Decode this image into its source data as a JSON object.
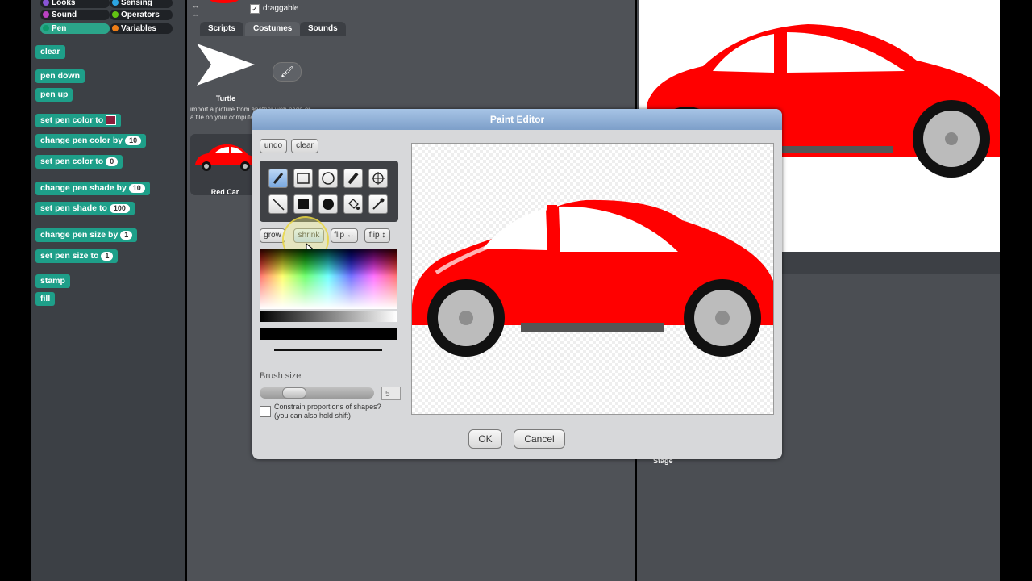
{
  "palette": {
    "categories": [
      {
        "label": "Looks",
        "color": "#8a55d7",
        "selected": false
      },
      {
        "label": "Sensing",
        "color": "#2ca5e2",
        "selected": false
      },
      {
        "label": "Sound",
        "color": "#bb42c3",
        "selected": false
      },
      {
        "label": "Operators",
        "color": "#62c213",
        "selected": false
      },
      {
        "label": "Pen",
        "color": "#0e9a6c",
        "selected": true
      },
      {
        "label": "Variables",
        "color": "#ee7d16",
        "selected": false
      }
    ],
    "blocks": {
      "clear": "clear",
      "pen_down": "pen down",
      "pen_up": "pen up",
      "set_pen_color": "set pen color to",
      "change_pen_color": "change pen color by",
      "change_pen_color_val": "10",
      "set_pen_color_num": "set pen color to",
      "set_pen_color_num_val": "0",
      "change_pen_shade": "change pen shade by",
      "change_pen_shade_val": "10",
      "set_pen_shade": "set pen shade to",
      "set_pen_shade_val": "100",
      "change_pen_size": "change pen size by",
      "change_pen_size_val": "1",
      "set_pen_size": "set pen size to",
      "set_pen_size_val": "1",
      "stamp": "stamp",
      "fill": "fill"
    }
  },
  "sprite": {
    "draggable_label": "draggable",
    "tabs": [
      "Scripts",
      "Costumes",
      "Sounds"
    ],
    "costumes": [
      {
        "name": "Turtle"
      },
      {
        "name": "Red Car"
      }
    ],
    "import_text": "import a picture from another web page or",
    "import_text2": "a file on your computer"
  },
  "stage": {
    "label": "Stage"
  },
  "paint_editor": {
    "title": "Paint Editor",
    "undo": "undo",
    "clear": "clear",
    "grow": "grow",
    "shrink": "shrink",
    "flip_h": "flip ↔",
    "flip_v": "flip ↕",
    "brush_size_label": "Brush size",
    "brush_size_value": "5",
    "brush_size_fraction": 0.25,
    "constrain_label": "Constrain proportions of shapes?",
    "constrain_hint": "(you can also hold shift)",
    "ok": "OK",
    "cancel": "Cancel"
  },
  "colors": {
    "car_red": "#ff0000",
    "accent_blue": "#7aa7df",
    "pen_category": "#2ba58a"
  }
}
